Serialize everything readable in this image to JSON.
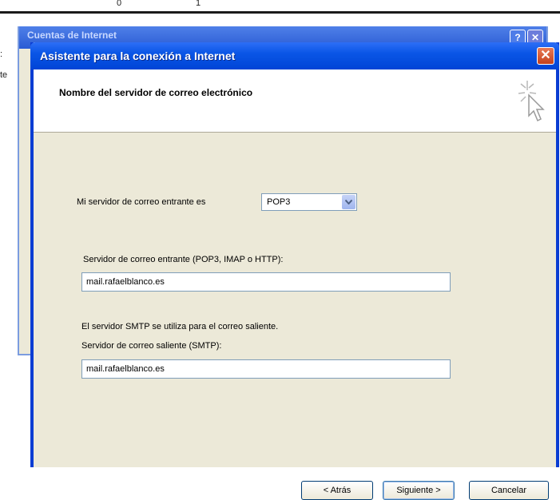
{
  "background": {
    "ruler_marks": [
      "0",
      "1"
    ],
    "left_chars": [
      ":",
      "te"
    ],
    "window_title": "Cuentas de Internet",
    "help_label": "?",
    "close_label": "✕"
  },
  "wizard": {
    "title": "Asistente para la conexión a Internet",
    "close_label": "✕",
    "header_title": "Nombre del servidor de correo electrónico",
    "incoming_type_label": "Mi servidor de correo entrante es",
    "incoming_type_value": "POP3",
    "incoming_server_label": "Servidor de correo entrante (POP3, IMAP o HTTP):",
    "incoming_server_value": "mail.rafaelblanco.es",
    "smtp_note": "El servidor SMTP se utiliza para el correo saliente.",
    "outgoing_server_label": "Servidor de correo saliente (SMTP):",
    "outgoing_server_value": "mail.rafaelblanco.es",
    "buttons": {
      "back": "< Atrás",
      "next": "Siguiente >",
      "cancel": "Cancelar"
    }
  },
  "colors": {
    "titlebar_blue": "#0a56e6",
    "dialog_bg": "#ece9d8",
    "close_red": "#c4411d"
  },
  "icons": [
    "wizard-sparkle-cursor-icon",
    "dropdown-arrow-icon",
    "close-icon",
    "help-icon"
  ]
}
